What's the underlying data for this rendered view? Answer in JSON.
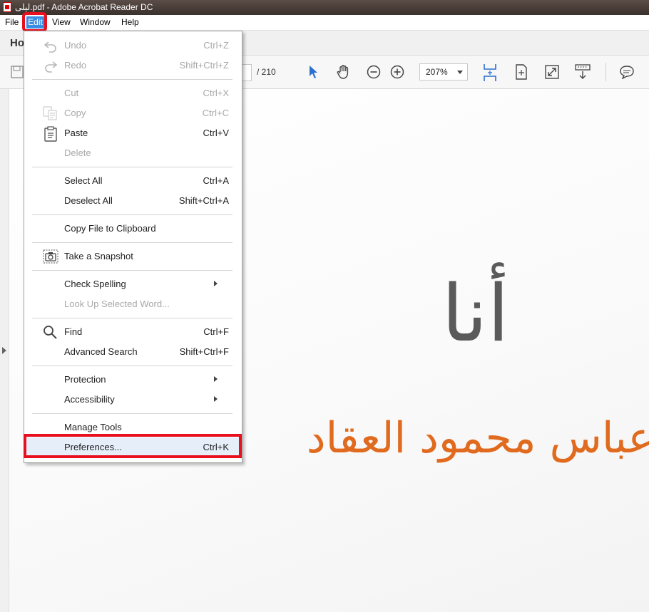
{
  "window": {
    "title": "لیلی.pdf - Adobe Acrobat Reader DC"
  },
  "menubar": {
    "file": "File",
    "edit": "Edit",
    "view": "View",
    "window": "Window",
    "help": "Help"
  },
  "tabs": {
    "home": "Ho"
  },
  "toolbar": {
    "page_total": "/ 210",
    "zoom": "207%"
  },
  "edit_menu": {
    "undo": {
      "label": "Undo",
      "shortcut": "Ctrl+Z"
    },
    "redo": {
      "label": "Redo",
      "shortcut": "Shift+Ctrl+Z"
    },
    "cut": {
      "label": "Cut",
      "shortcut": "Ctrl+X"
    },
    "copy": {
      "label": "Copy",
      "shortcut": "Ctrl+C"
    },
    "paste": {
      "label": "Paste",
      "shortcut": "Ctrl+V"
    },
    "delete": {
      "label": "Delete",
      "shortcut": ""
    },
    "select_all": {
      "label": "Select All",
      "shortcut": "Ctrl+A"
    },
    "deselect_all": {
      "label": "Deselect All",
      "shortcut": "Shift+Ctrl+A"
    },
    "copy_file": {
      "label": "Copy File to Clipboard"
    },
    "snapshot": {
      "label": "Take a Snapshot"
    },
    "check_spelling": {
      "label": "Check Spelling"
    },
    "look_up": {
      "label": "Look Up Selected Word..."
    },
    "find": {
      "label": "Find",
      "shortcut": "Ctrl+F"
    },
    "advanced_search": {
      "label": "Advanced Search",
      "shortcut": "Shift+Ctrl+F"
    },
    "protection": {
      "label": "Protection"
    },
    "accessibility": {
      "label": "Accessibility"
    },
    "manage_tools": {
      "label": "Manage Tools"
    },
    "preferences": {
      "label": "Preferences...",
      "shortcut": "Ctrl+K"
    }
  },
  "document": {
    "title_text": "أنا",
    "author_text": "عباس محمود العقاد"
  },
  "colors": {
    "highlight": "#e8101f",
    "accent": "#3b8de3",
    "arabic_orange": "#e06a1e"
  }
}
